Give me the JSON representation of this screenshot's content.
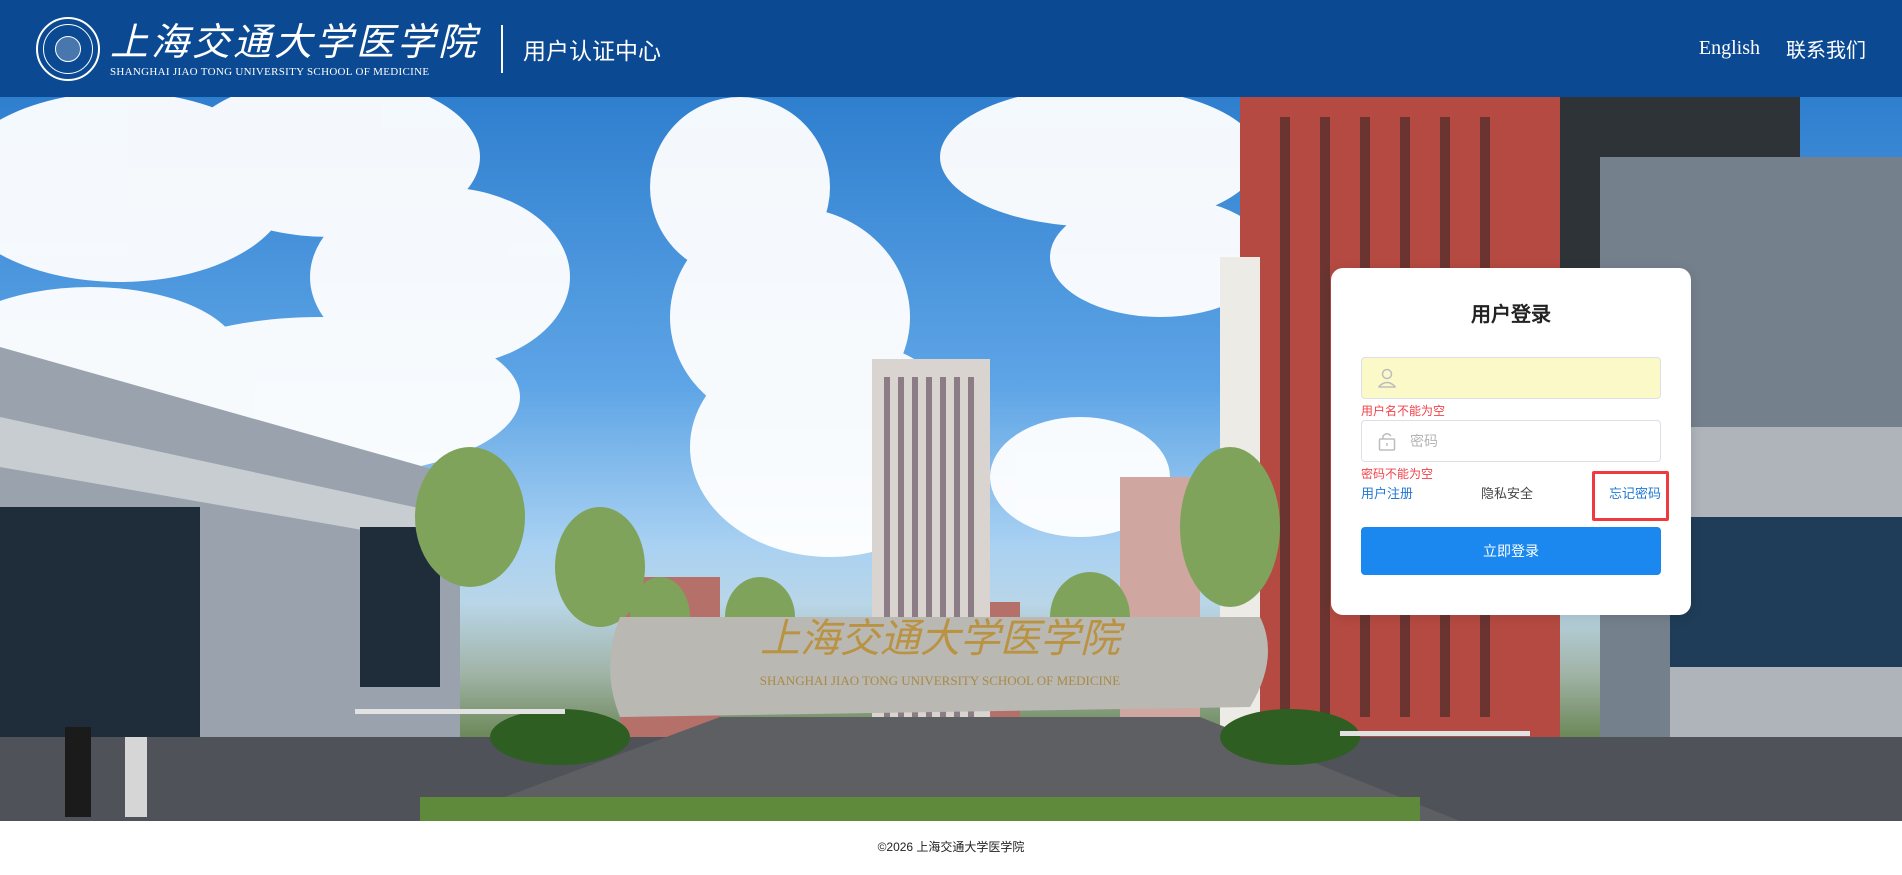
{
  "header": {
    "brand_cn": "上海交通大学医学院",
    "brand_en": "SHANGHAI JIAO TONG UNIVERSITY SCHOOL OF MEDICINE",
    "center_title": "用户认证中心",
    "nav": {
      "english": "English",
      "contact": "联系我们"
    },
    "color": "#0b4a92"
  },
  "hero": {
    "stone_cn": "上海交通大学医学院",
    "stone_en": "SHANGHAI JIAO TONG UNIVERSITY SCHOOL OF MEDICINE"
  },
  "login": {
    "title": "用户登录",
    "username": {
      "value": "",
      "placeholder": "",
      "error": "用户名不能为空"
    },
    "password": {
      "value": "",
      "placeholder": "密码",
      "error": "密码不能为空"
    },
    "links": {
      "register": "用户注册",
      "privacy": "隐私安全",
      "forgot": "忘记密码"
    },
    "submit": "立即登录",
    "accent": "#1a88ee",
    "error_color": "#f0434a"
  },
  "footer": {
    "copyright": "©2026 上海交通大学医学院"
  }
}
